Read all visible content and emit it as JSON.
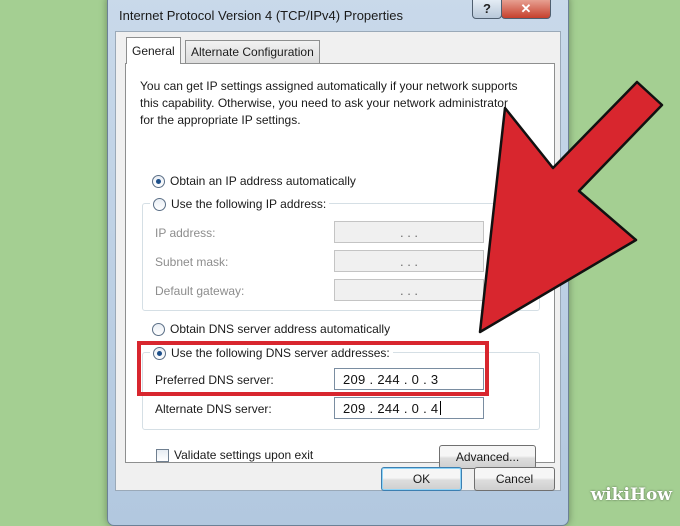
{
  "window": {
    "title": "Internet Protocol Version 4 (TCP/IPv4) Properties",
    "help_label": "?",
    "close_label": "✕"
  },
  "tabs": [
    {
      "label": "General",
      "active": true
    },
    {
      "label": "Alternate Configuration",
      "active": false
    }
  ],
  "description": "You can get IP settings assigned automatically if your network supports\nthis capability. Otherwise, you need to ask your network administrator\nfor the appropriate IP settings.",
  "ip_options": {
    "auto_label": "Obtain an IP address automatically",
    "manual_label": "Use the following IP address:",
    "selected": "auto"
  },
  "ip_fields": [
    {
      "label": "IP address:",
      "value": ". . ."
    },
    {
      "label": "Subnet mask:",
      "value": ". . ."
    },
    {
      "label": "Default gateway:",
      "value": ". . ."
    }
  ],
  "dns_options": {
    "auto_label": "Obtain DNS server address automatically",
    "manual_label": "Use the following DNS server addresses:",
    "selected": "manual"
  },
  "dns_fields": [
    {
      "label": "Preferred DNS server:",
      "value": "209 . 244 . 0 . 3"
    },
    {
      "label": "Alternate DNS server:",
      "value": "209 . 244 . 0 . 4"
    }
  ],
  "validate_label": "Validate settings upon exit",
  "validate_checked": false,
  "buttons": {
    "advanced": "Advanced...",
    "ok": "OK",
    "cancel": "Cancel"
  },
  "annotation": {
    "arrow_color": "#d8262e",
    "box_color": "#d8262e"
  },
  "watermark": "wikiHow"
}
